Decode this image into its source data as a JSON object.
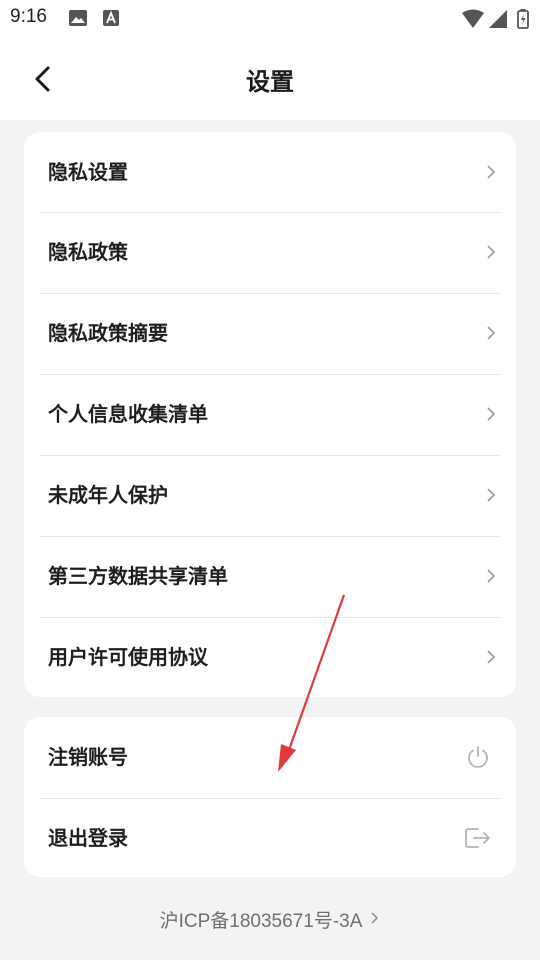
{
  "status_bar": {
    "time": "9:16",
    "icons": [
      "image-icon",
      "font-icon",
      "wifi-icon",
      "signal-icon",
      "battery-icon"
    ]
  },
  "header": {
    "title": "设置",
    "back_icon": "back-arrow-icon"
  },
  "settings_group": {
    "items": [
      {
        "label": "隐私设置",
        "icon": "chevron-right-icon"
      },
      {
        "label": "隐私政策",
        "icon": "chevron-right-icon"
      },
      {
        "label": "隐私政策摘要",
        "icon": "chevron-right-icon"
      },
      {
        "label": "个人信息收集清单",
        "icon": "chevron-right-icon"
      },
      {
        "label": "未成年人保护",
        "icon": "chevron-right-icon"
      },
      {
        "label": "第三方数据共享清单",
        "icon": "chevron-right-icon"
      },
      {
        "label": "用户许可使用协议",
        "icon": "chevron-right-icon"
      }
    ]
  },
  "account_group": {
    "items": [
      {
        "label": "注销账号",
        "icon": "power-icon"
      },
      {
        "label": "退出登录",
        "icon": "logout-icon"
      }
    ]
  },
  "footer": {
    "icp_text": "沪ICP备18035671号-3A",
    "icon": "chevron-right-icon"
  },
  "colors": {
    "background": "#f3f3f4",
    "card": "#ffffff",
    "annotation_arrow": "#e0393e"
  }
}
